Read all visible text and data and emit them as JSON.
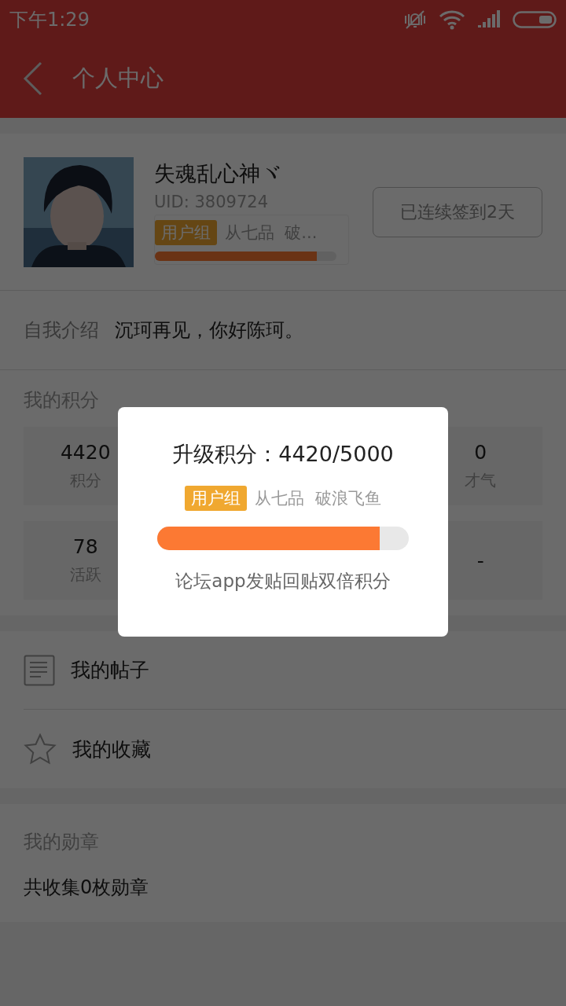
{
  "status_bar": {
    "time": "下午1:29"
  },
  "header": {
    "title": "个人中心"
  },
  "profile": {
    "name": "失魂乱心神ヾ",
    "uid": "UID: 3809724",
    "group_tag": "用户组",
    "group_text": "从七品  破...",
    "level": 0.89,
    "checkin_button": "已连续签到2天"
  },
  "intro": {
    "label": "自我介绍",
    "text": "沉珂再见，你好陈珂。"
  },
  "points": {
    "title": "我的积分",
    "items": [
      {
        "value": "4420",
        "label": "积分"
      },
      {
        "value": "0",
        "label": "才气"
      },
      {
        "value": "78",
        "label": "活跃"
      },
      {
        "value": "-"
      }
    ]
  },
  "menu": [
    {
      "kind": "posts",
      "label": "我的帖子"
    },
    {
      "kind": "favorites",
      "label": "我的收藏"
    }
  ],
  "medals": {
    "title": "我的勋章",
    "text": "共收集0枚勋章"
  },
  "dialog": {
    "title": "升级积分：4420/5000",
    "group_tag": "用户组",
    "group_text": "从七品  破浪飞鱼",
    "level": 0.885,
    "note": "论坛app发贴回贴双倍积分"
  }
}
